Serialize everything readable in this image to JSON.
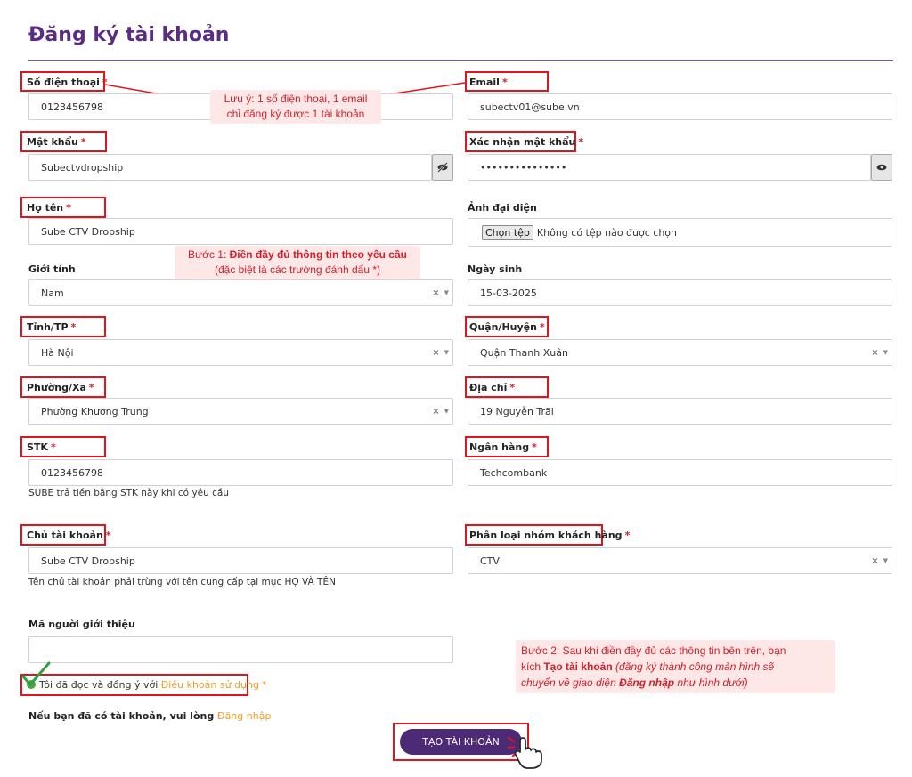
{
  "page": {
    "title": "Đăng ký tài khoản"
  },
  "fields": {
    "phone": {
      "label": "Số điện thoại",
      "value": "0123456798"
    },
    "email": {
      "label": "Email",
      "value": "subectv01@sube.vn"
    },
    "password": {
      "label": "Mật khẩu",
      "value": "Subectvdropship"
    },
    "confirm_password": {
      "label": "Xác nhận mật khẩu",
      "value": "•••••••••••••••"
    },
    "fullname": {
      "label": "Họ tên",
      "value": "Sube CTV Dropship"
    },
    "avatar": {
      "label": "Ảnh đại diện",
      "button": "Chọn tệp",
      "status": "Không có tệp nào được chọn"
    },
    "gender": {
      "label": "Giới tính",
      "value": "Nam"
    },
    "birthday": {
      "label": "Ngày sinh",
      "value": "15-03-2025"
    },
    "province": {
      "label": "Tỉnh/TP",
      "value": "Hà Nội"
    },
    "district": {
      "label": "Quận/Huyện",
      "value": "Quận Thanh Xuân"
    },
    "ward": {
      "label": "Phường/Xã",
      "value": "Phường Khương Trung"
    },
    "address": {
      "label": "Địa chỉ",
      "value": "19 Nguyễn Trãi"
    },
    "account_number": {
      "label": "STK",
      "value": "0123456798",
      "help": "SUBE trả tiền bằng STK này khi có yêu cầu"
    },
    "bank": {
      "label": "Ngân hàng",
      "value": "Techcombank"
    },
    "account_holder": {
      "label": "Chủ tài khoản",
      "value": "Sube CTV Dropship",
      "help": "Tên chủ tài khoản phải trùng với tên cung cấp tại mục HỌ VÀ TÊN"
    },
    "customer_group": {
      "label": "Phân loại nhóm khách hàng",
      "value": "CTV"
    },
    "referrer": {
      "label": "Mã người giới thiệu",
      "value": ""
    }
  },
  "required_mark": "*",
  "select_clear": "×",
  "terms": {
    "prefix": "Tôi đã đọc và đồng ý với",
    "link": "Điều khoản sử dụng"
  },
  "login_prompt": {
    "text": "Nếu bạn đã có tài khoản, vui lòng",
    "link": "Đăng nhập"
  },
  "submit_label": "TẠO TÀI KHOẢN",
  "annotations": {
    "note_unique": {
      "line1": "Lưu ý: 1 số điện thoại, 1 email",
      "line2": "chỉ đăng ký được 1 tài khoản"
    },
    "step1": {
      "prefix": "Bước 1: ",
      "bold": "Điền đầy đủ thông tin theo yêu cầu",
      "line2": "(đặc biệt là các trường đánh dấu *)"
    },
    "step2": {
      "line1": "Bước 2: Sau khi điền đầy đủ các thông tin bên trên, bạn",
      "l2a": "kích ",
      "l2b": "Tạo tài khoản",
      "l2c": " (đăng ký thành công màn hình sẽ",
      "l3a": "chuyển về giao diện ",
      "l3b": "Đăng nhập",
      "l3c": " như hình dưới)"
    }
  },
  "colors": {
    "brand": "#5b2d82",
    "button": "#4c2a75",
    "highlight": "#e0141e",
    "link": "#f39a23",
    "note_bg": "#fde7e7"
  }
}
